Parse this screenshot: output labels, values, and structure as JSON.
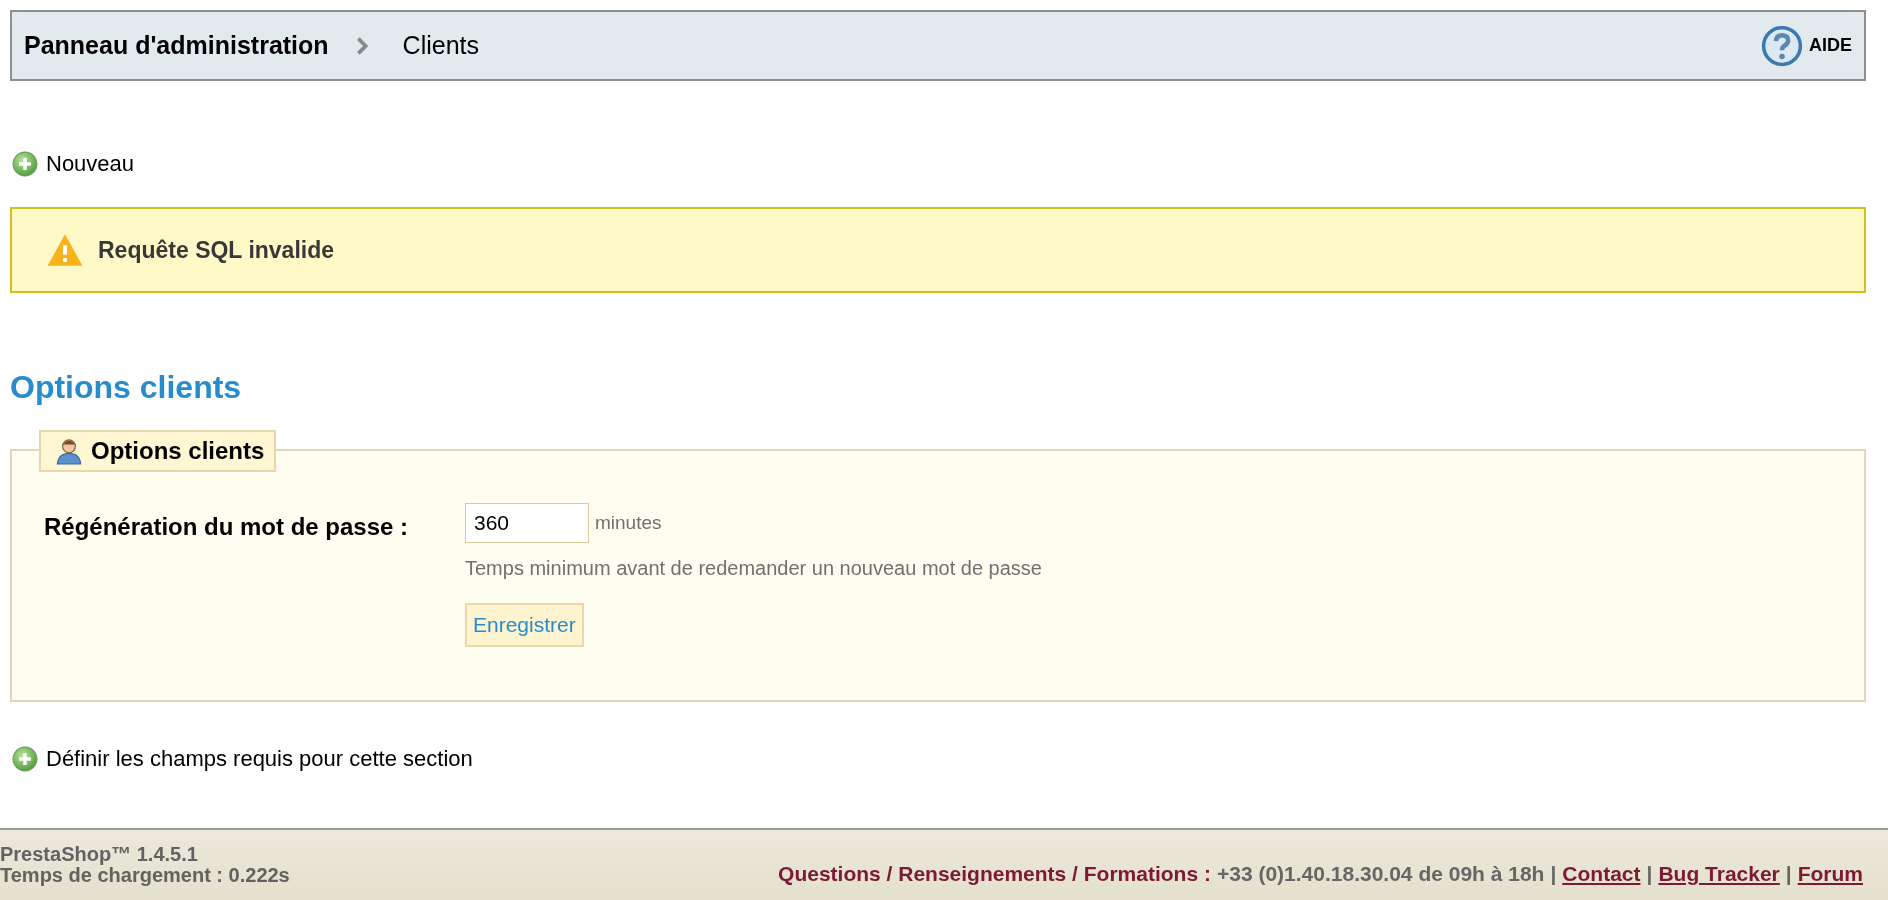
{
  "breadcrumb": {
    "items": [
      {
        "label": "Panneau d'administration",
        "current": false
      },
      {
        "label": "Clients",
        "current": true
      }
    ],
    "help": "AIDE"
  },
  "new_link": "Nouveau",
  "alert": {
    "kind": "warning",
    "message": "Requête SQL invalide"
  },
  "section_title": "Options clients",
  "fieldset": {
    "legend": "Options clients",
    "fields": [
      {
        "label": "Régénération du mot de passe :",
        "value": "360",
        "unit": "minutes",
        "hint": "Temps minimum avant de redemander un nouveau mot de passe"
      }
    ],
    "submit": "Enregistrer"
  },
  "required_link": "Définir les champs requis pour cette section",
  "footer": {
    "version": "PrestaShop™ 1.4.5.1",
    "load_time": "Temps de chargement : 0.222s",
    "contact_label": "Questions / Renseignements / Formations :",
    "contact_info": "+33 (0)1.40.18.30.04 de 09h à 18h",
    "separator": "|",
    "links": [
      "Contact",
      "Bug Tracker",
      "Forum"
    ]
  }
}
